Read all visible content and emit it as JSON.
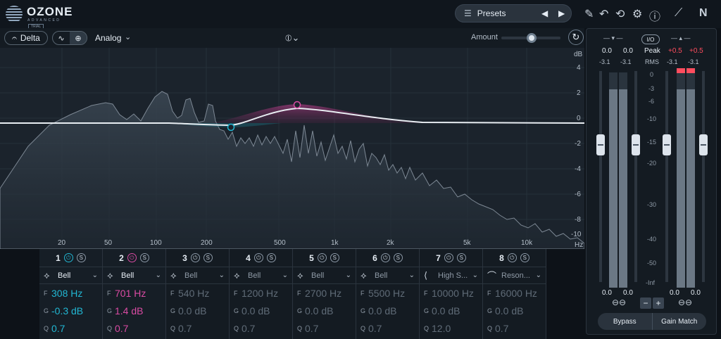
{
  "app": {
    "name": "OZONE",
    "subtitle": "ADVANCED",
    "badge": "TRIAL"
  },
  "toolbar": {
    "presets_label": "Presets",
    "delta_label": "Delta",
    "analog_label": "Analog",
    "amount_label": "Amount",
    "amount_value": 0.5
  },
  "spectrum": {
    "db_unit": "dB",
    "hz_unit": "Hz",
    "db_ticks": [
      "4",
      "2",
      "0",
      "-2",
      "-4",
      "-6",
      "-8",
      "-10"
    ],
    "hz_ticks": [
      "20",
      "50",
      "100",
      "200",
      "500",
      "1k",
      "2k",
      "5k",
      "10k"
    ]
  },
  "bands": [
    {
      "num": "1",
      "type": "Bell",
      "freq": "308 Hz",
      "gain": "-0.3 dB",
      "q": "0.7",
      "color": "#22b7d3",
      "active": true
    },
    {
      "num": "2",
      "type": "Bell",
      "freq": "701 Hz",
      "gain": "1.4 dB",
      "q": "0.7",
      "color": "#d94ba3",
      "active": true
    },
    {
      "num": "3",
      "type": "Bell",
      "freq": "540 Hz",
      "gain": "0.0 dB",
      "q": "0.7",
      "active": false
    },
    {
      "num": "4",
      "type": "Bell",
      "freq": "1200 Hz",
      "gain": "0.0 dB",
      "q": "0.7",
      "active": false
    },
    {
      "num": "5",
      "type": "Bell",
      "freq": "2700 Hz",
      "gain": "0.0 dB",
      "q": "0.7",
      "active": false
    },
    {
      "num": "6",
      "type": "Bell",
      "freq": "5500 Hz",
      "gain": "0.0 dB",
      "q": "0.7",
      "active": false
    },
    {
      "num": "7",
      "type": "High S...",
      "freq": "10000 Hz",
      "gain": "0.0 dB",
      "q": "12.0",
      "active": false
    },
    {
      "num": "8",
      "type": "Reson...",
      "freq": "16000 Hz",
      "gain": "0.0 dB",
      "q": "0.7",
      "active": false
    }
  ],
  "band_keys": {
    "f": "F",
    "g": "G",
    "q": "Q"
  },
  "meter": {
    "io_label": "I/O",
    "peak_label": "Peak",
    "rms_label": "RMS",
    "in_peak_l": "0.0",
    "in_peak_r": "0.0",
    "in_rms_l": "-3.1",
    "in_rms_r": "-3.1",
    "out_peak_l": "+0.5",
    "out_peak_r": "+0.5",
    "out_rms_l": "-3.1",
    "out_rms_r": "-3.1",
    "scale": [
      "0",
      "-3",
      "-6",
      "-10",
      "-15",
      "-20",
      "-30",
      "-40",
      "-50",
      "-Inf"
    ],
    "in_gain_l": "0.0",
    "in_gain_r": "0.0",
    "out_gain_l": "0.0",
    "out_gain_r": "0.0",
    "bypass_label": "Bypass",
    "gain_match_label": "Gain Match"
  }
}
